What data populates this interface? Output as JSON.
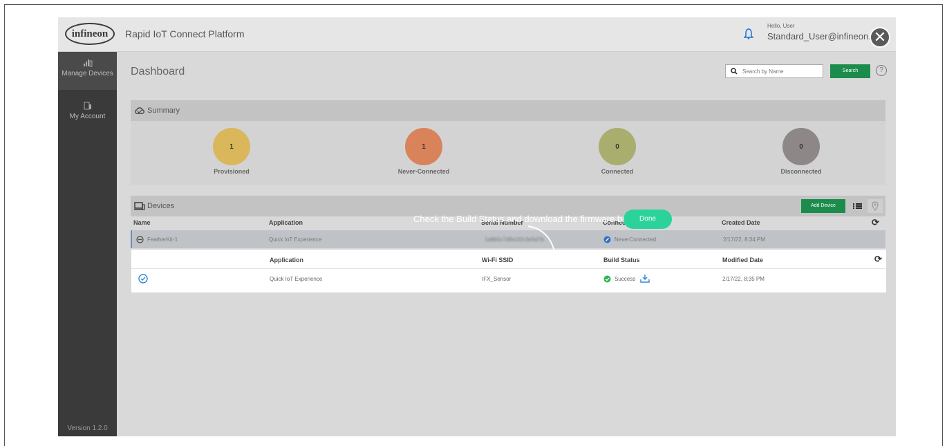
{
  "header": {
    "logo_text": "infineon",
    "app_title": "Rapid IoT Connect Platform",
    "hello": "Hello, User",
    "email": "Standard_User@infineon.co",
    "close_symbol": "✕"
  },
  "sidebar": {
    "items": [
      {
        "label": "Manage Devices",
        "icon": "devices-icon"
      },
      {
        "label": "My Account",
        "icon": "account-icon"
      }
    ],
    "version": "Version 1.2.0"
  },
  "dashboard": {
    "title": "Dashboard",
    "search_placeholder": "Search by Name",
    "search_button": "Search",
    "help": "?"
  },
  "summary": {
    "title": "Summary",
    "stats": [
      {
        "label": "Provisioned",
        "value": "1",
        "color": "#d9b75a"
      },
      {
        "label": "Never-Connected",
        "value": "1",
        "color": "#d9835a"
      },
      {
        "label": "Connected",
        "value": "0",
        "color": "#a9ad6e"
      },
      {
        "label": "Disconnected",
        "value": "0",
        "color": "#8d8787"
      }
    ]
  },
  "devices": {
    "title": "Devices",
    "add_button": "Add Device",
    "columns": [
      "Name",
      "Application",
      "Serial Number",
      "Connection Status",
      "Created Date"
    ],
    "rows": [
      {
        "name": "FeatherKit-1",
        "application": "Quick IoT Experience",
        "serial": "1a8b5c7d9e1f2c3e5d7b",
        "status": "NeverConnected",
        "created": "2/17/22, 8:34 PM"
      }
    ],
    "detail": {
      "columns": [
        "Application",
        "Wi-Fi SSID",
        "Build Status",
        "Modified Date"
      ],
      "row": {
        "application": "Quick IoT Experience",
        "ssid": "IFX_Sensor",
        "build_status": "Success",
        "modified": "2/17/22, 8:35 PM"
      }
    }
  },
  "tutorial": {
    "text": "Check the Build Status and download the firmware bundle",
    "done_button": "Done"
  }
}
